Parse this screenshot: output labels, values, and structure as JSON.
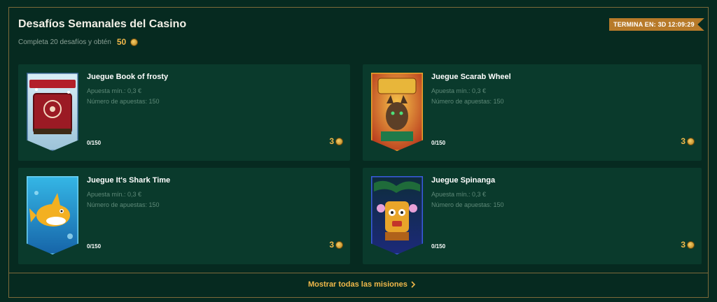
{
  "header": {
    "title": "Desafíos Semanales del Casino",
    "subtitle": "Completa 20 desafíos y obtén",
    "reward_amount": "50",
    "timer": "TERMINA EN: 3D 12:09:29"
  },
  "challenges": [
    {
      "title": "Juegue Book of frosty",
      "min_bet": "Apuesta mín.: 0,3 €",
      "bets": "Número de apuestas: 150",
      "progress": "0/150",
      "reward": "3",
      "thumb_label": "BOOK OF FROSTY"
    },
    {
      "title": "Juegue Scarab Wheel",
      "min_bet": "Apuesta mín.: 0,3 €",
      "bets": "Número de apuestas: 150",
      "progress": "0/150",
      "reward": "3",
      "thumb_label": "SCARAB WHEEL"
    },
    {
      "title": "Juegue It's Shark Time",
      "min_bet": "Apuesta mín.: 0,3 €",
      "bets": "Número de apuestas: 150",
      "progress": "0/150",
      "reward": "3",
      "thumb_label": ""
    },
    {
      "title": "Juegue Spinanga",
      "min_bet": "Apuesta mín.: 0,3 €",
      "bets": "Número de apuestas: 150",
      "progress": "0/150",
      "reward": "3",
      "thumb_label": ""
    }
  ],
  "footer": {
    "show_all": "Mostrar todas las misiones"
  },
  "colors": {
    "background": "#062a20",
    "card": "#0a3a2c",
    "accent_gold": "#f0b84a",
    "timer_badge": "#b77a2a",
    "border": "#7d6a3a"
  }
}
